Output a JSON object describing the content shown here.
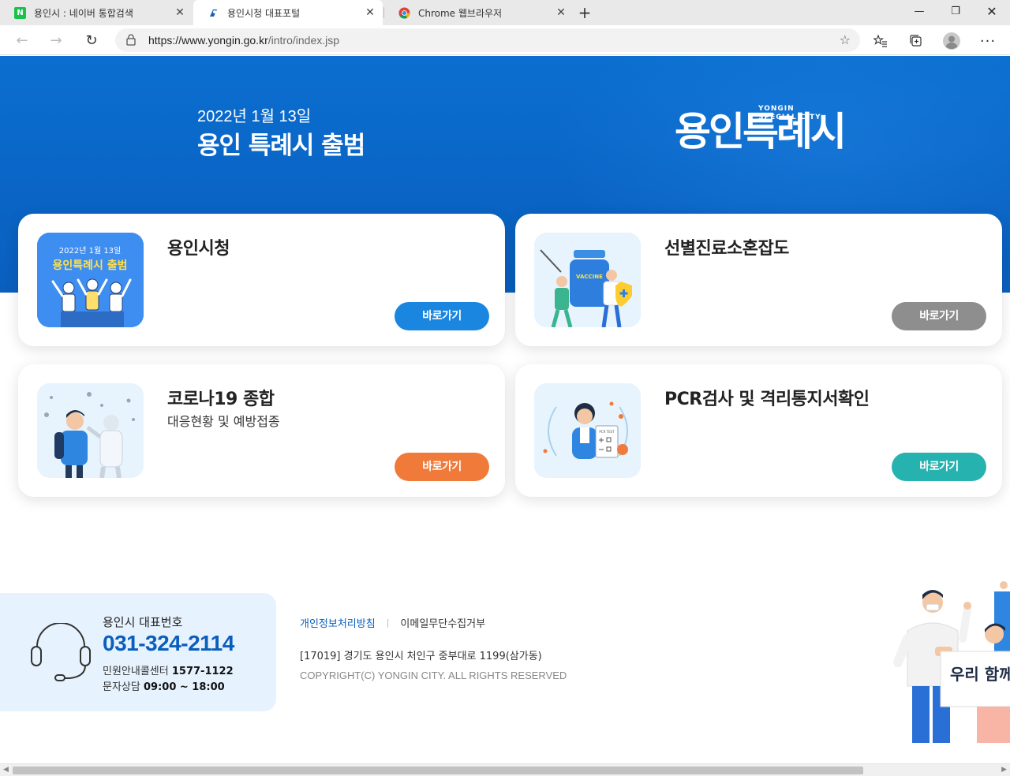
{
  "browser": {
    "tabs": [
      {
        "title": "용인시 : 네이버 통합검색",
        "favicon": "N"
      },
      {
        "title": "용인시청 대표포털"
      },
      {
        "title": "Chrome 웹브라우저"
      }
    ],
    "url_host": "https://www.yongin.go.kr",
    "url_path": "/intro/index.jsp"
  },
  "hero": {
    "date": "2022년 1월 13일",
    "title": "용인 특례시 출범",
    "logo_text": "용인특례시",
    "logo_en_line1": "YONGIN",
    "logo_en_line2": "SPECIAL CITY"
  },
  "cards": [
    {
      "title": "용인시청",
      "subtitle": "",
      "button": "바로가기",
      "button_color": "#1a86e0",
      "thumb_date": "2022년 1월 13일",
      "thumb_title": "용인특례시 출범"
    },
    {
      "title": "선별진료소혼잡도",
      "subtitle": "",
      "button": "바로가기",
      "button_color": "#8e8e8e",
      "thumb_label": "VACCINE"
    },
    {
      "title": "코로나19 종합",
      "subtitle": "대응현황 및 예방접종",
      "button": "바로가기",
      "button_color": "#f07a3a"
    },
    {
      "title": "PCR검사 및 격리통지서확인",
      "subtitle": "",
      "button": "바로가기",
      "button_color": "#26b3b0",
      "thumb_label": "PCR TEST"
    }
  ],
  "footer": {
    "phone_label": "용인시 대표번호",
    "phone_number": "031-324-2114",
    "callcenter_label": "민원안내콜센터",
    "callcenter_number": "1577-1122",
    "sms_label": "문자상담",
    "sms_hours": "09:00 ~ 18:00",
    "link_privacy": "개인정보처리방침",
    "link_email": "이메일무단수집거부",
    "address": "[17019] 경기도 용인시 처인구 중부대로 1199(삼가동)",
    "copyright": "COPYRIGHT(C) YONGIN CITY. ALL RIGHTS RESERVED",
    "banner_text": "우리 함께"
  },
  "colors": {
    "hero_blue": "#0a65c6",
    "accent_blue": "#0a5fbe"
  }
}
